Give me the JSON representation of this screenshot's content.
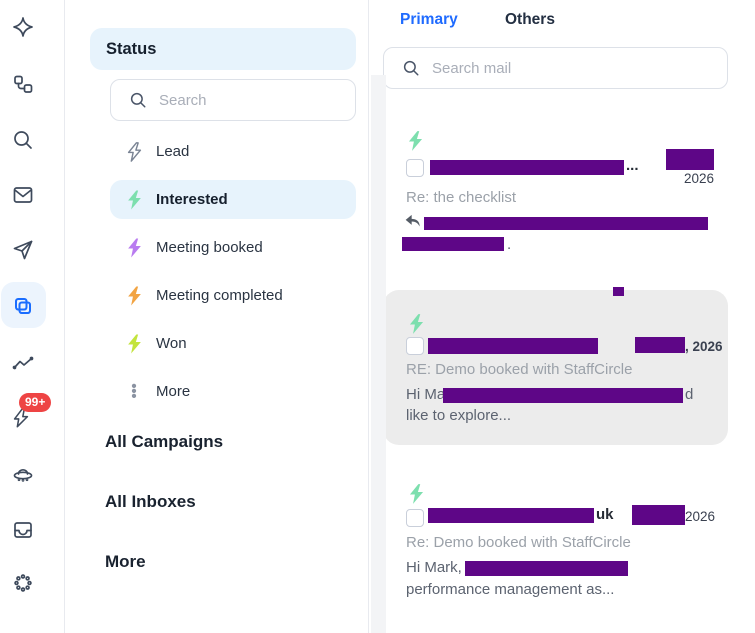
{
  "rail": {
    "notification_badge": "99+",
    "icons": [
      "sparkle",
      "workflow",
      "search",
      "mail",
      "send",
      "copy",
      "analytics",
      "lightning",
      "ufo",
      "inbox",
      "settings"
    ]
  },
  "sidebar": {
    "title": "Status",
    "search": {
      "placeholder": "Search"
    },
    "statuses": [
      {
        "label": "Lead",
        "color": "#7a8494",
        "style": "outline",
        "selected": false
      },
      {
        "label": "Interested",
        "color": "#7ddfae",
        "selected": true
      },
      {
        "label": "Meeting booked",
        "color": "#b97cf0",
        "selected": false
      },
      {
        "label": "Meeting completed",
        "color": "#f2a443",
        "selected": false
      },
      {
        "label": "Won",
        "color": "#c3e43d",
        "selected": false
      },
      {
        "label": "More",
        "selected": false
      }
    ],
    "sections": [
      {
        "label": "All Campaigns"
      },
      {
        "label": "All Inboxes"
      },
      {
        "label": "More"
      }
    ]
  },
  "main": {
    "tabs": [
      {
        "label": "Primary",
        "active": true
      },
      {
        "label": "Others",
        "active": false
      }
    ],
    "search": {
      "placeholder": "Search mail"
    },
    "emails": [
      {
        "status": "Interested",
        "sender_redacted": true,
        "sender_tail": "...",
        "date_tail": "2026",
        "subject": "Re: the checklist",
        "preview_line1_redacted": true,
        "preview_line2_tail": "."
      },
      {
        "status": "Interested",
        "selected": true,
        "sender_redacted": true,
        "date_tail": ", 2026",
        "subject": "RE: Demo booked with StaffCircle",
        "preview_prefix": "Hi Mark,",
        "preview_mid_tail": "d",
        "preview_line2": "like to explore..."
      },
      {
        "status": "Interested",
        "sender_redacted": true,
        "sender_tail": "uk",
        "date_tail": "2026",
        "subject": "Re: Demo booked with StaffCircle",
        "preview_prefix": "Hi Mark,",
        "preview_line2": "performance management as..."
      }
    ]
  },
  "colors": {
    "accent_blue": "#1f6bff",
    "redaction_purple": "#5e0687",
    "selected_bg": "#e7f3fc",
    "card_bg": "#ececec",
    "badge_red": "#ee4444",
    "status_green": "#7ddfae",
    "status_purple": "#b97cf0",
    "status_orange": "#f2a443",
    "status_lime": "#c3e43d"
  }
}
